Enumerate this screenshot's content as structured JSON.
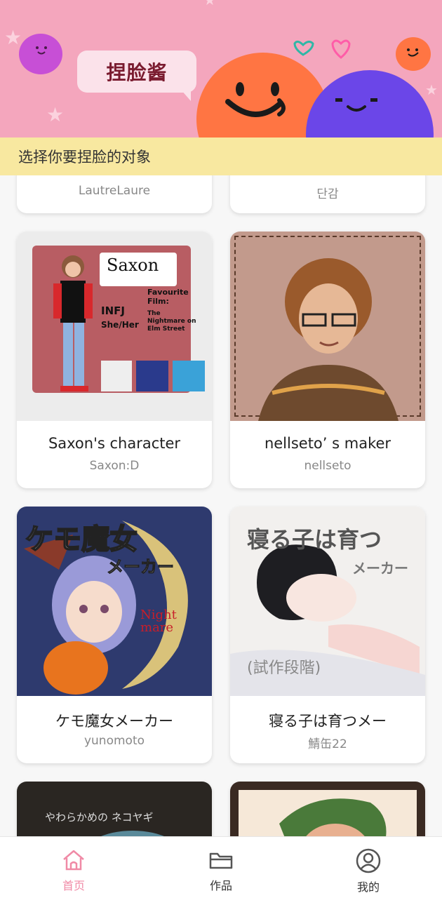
{
  "header": {
    "title": "捏脸酱",
    "subtitle": "选择你要捏脸的对象"
  },
  "cards_partial_top": [
    {
      "author": "LautreLaure"
    },
    {
      "author": "단감"
    }
  ],
  "cards": [
    {
      "title": "Saxon's character",
      "author": "Saxon:D",
      "thumb_icon": "character-art-saxon",
      "thumb_text": {
        "name": "Saxon",
        "mbti": "INFJ",
        "pronouns": "She/Her",
        "fav": "Favourite Film:",
        "film": "The Nightmare on Elm Street"
      }
    },
    {
      "title": "nellseto’ s maker",
      "author": "nellseto",
      "thumb_icon": "character-art-nellseto"
    },
    {
      "title": "ケモ魔女メーカー",
      "author": "yunomoto",
      "thumb_icon": "character-art-witch",
      "thumb_text": {
        "big": "ケモ魔女",
        "sub": "メーカー",
        "tag": "Night mare"
      }
    },
    {
      "title": "寝る子は育つメー",
      "author": "鯖缶22",
      "thumb_icon": "character-art-sleeping",
      "thumb_text": {
        "big": "寝る子は育つ",
        "sub": "メーカー",
        "note": "(試作段階)"
      }
    }
  ],
  "cards_partial_bottom": [
    {
      "thumb_icon": "character-art-partial-left",
      "thumb_text": "やわらかめの ネコヤギ"
    },
    {
      "thumb_icon": "character-art-partial-right"
    }
  ],
  "tabs": [
    {
      "label": "首页",
      "icon": "home-icon",
      "active": true
    },
    {
      "label": "作品",
      "icon": "folder-icon",
      "active": false
    },
    {
      "label": "我的",
      "icon": "profile-icon",
      "active": false
    }
  ],
  "colors": {
    "banner": "#f4a6bd",
    "subtitle_bar": "#f8e8a0",
    "active_tab": "#f08aa6",
    "inactive_tab": "#555555"
  }
}
